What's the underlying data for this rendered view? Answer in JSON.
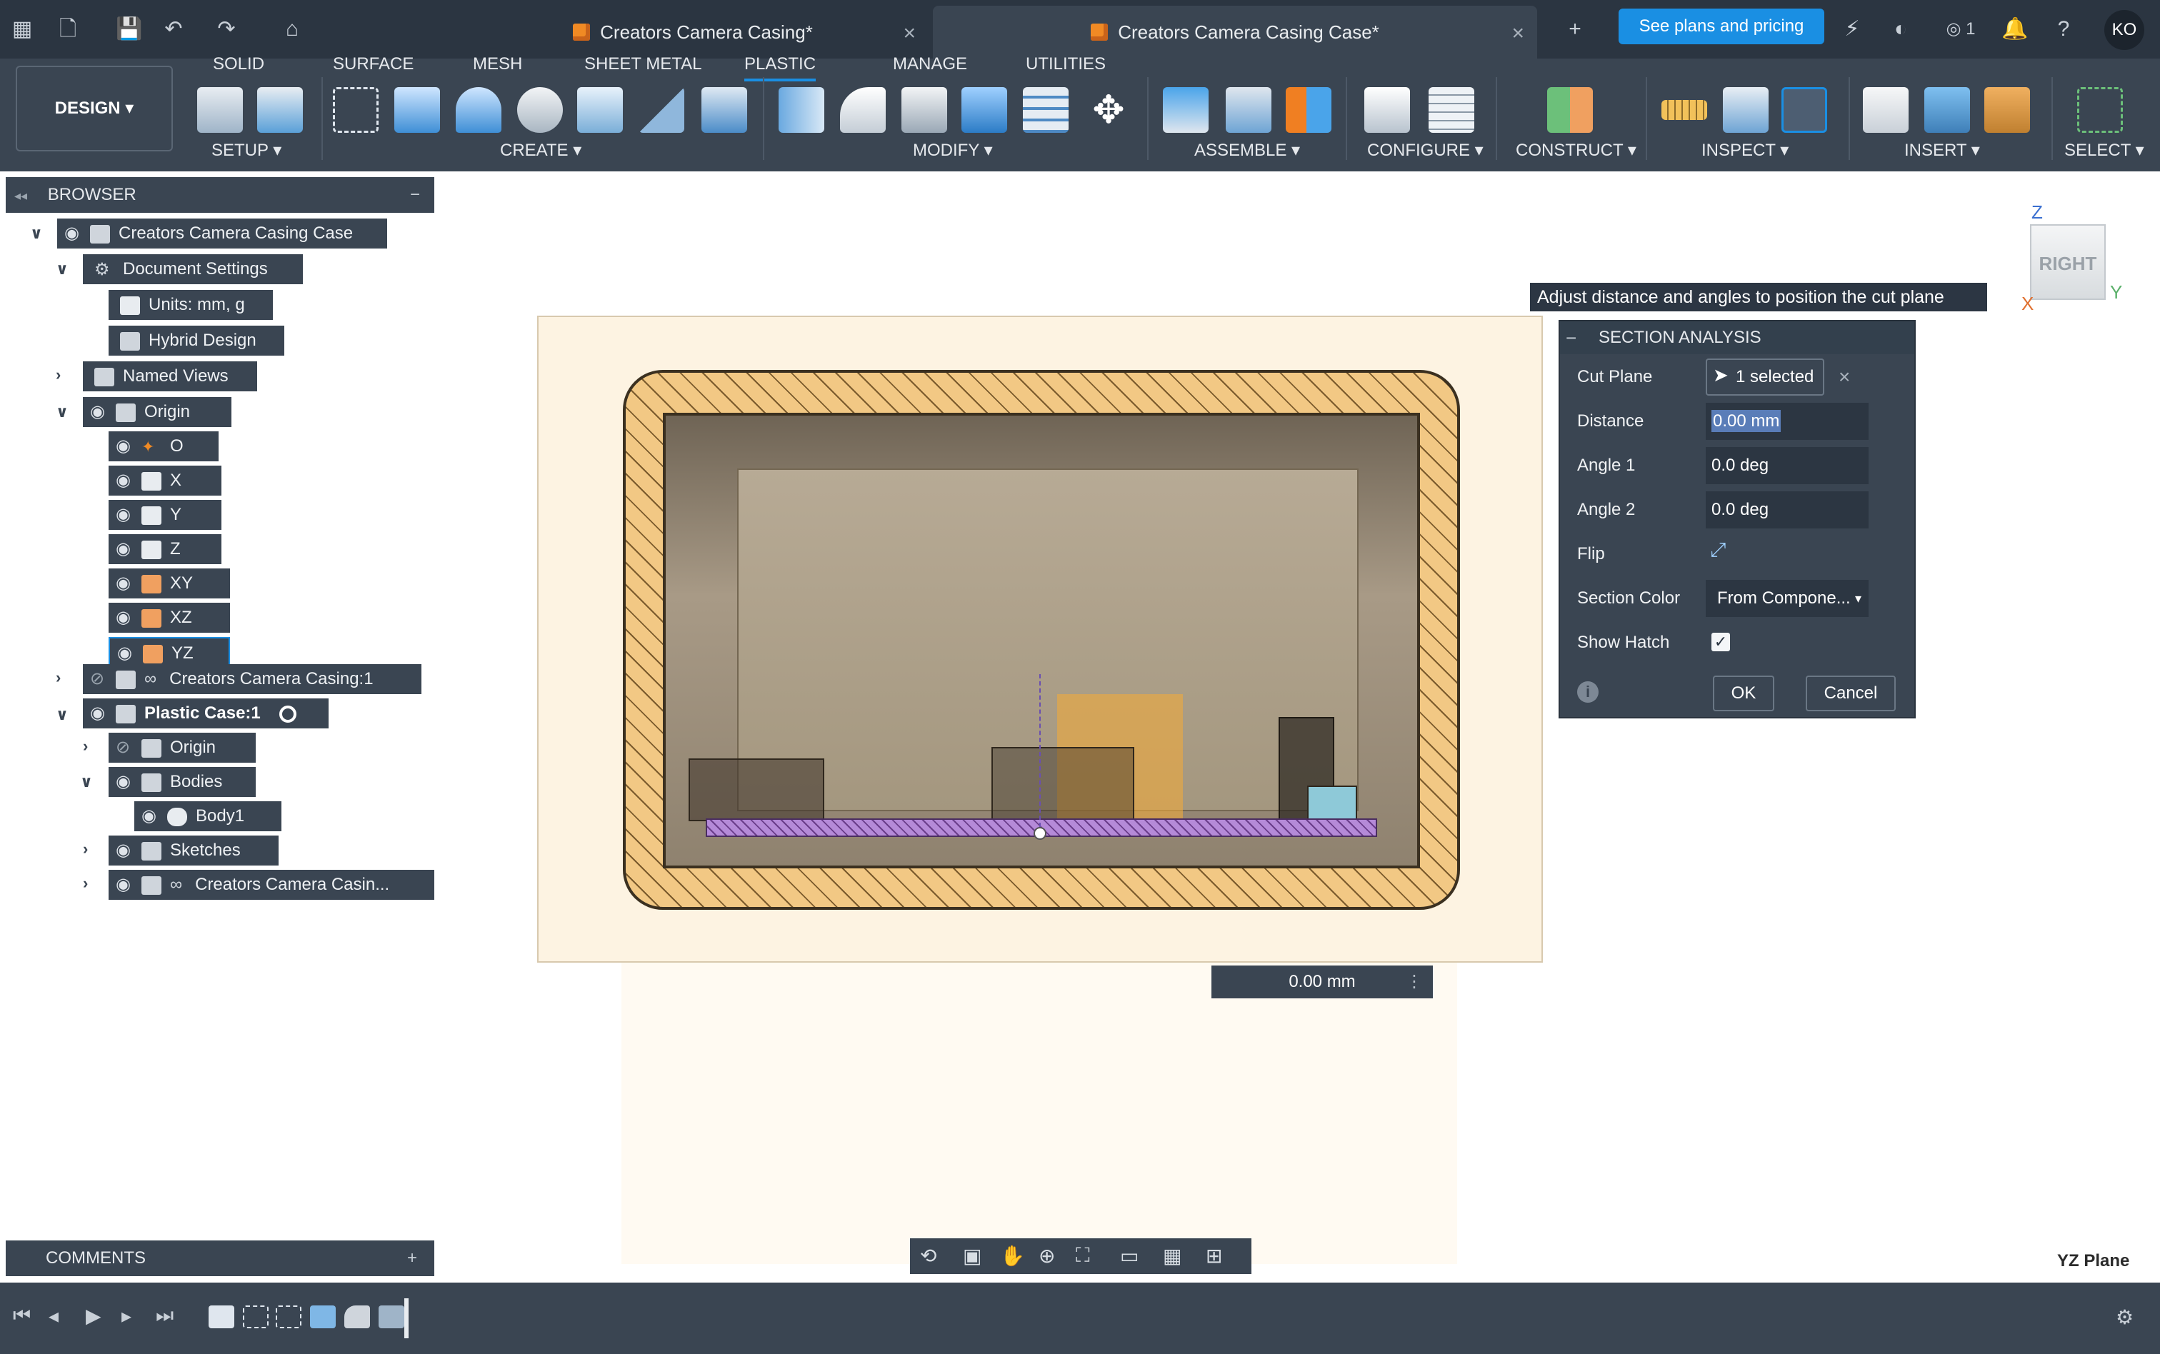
{
  "titlebar": {
    "tabs": [
      {
        "label": "Creators Camera Casing*"
      },
      {
        "label": "Creators Camera Casing Case*"
      }
    ],
    "plans_button": "See plans and pricing",
    "jobs_count": "1",
    "avatar_initials": "KO"
  },
  "toolbar": {
    "design_button": "DESIGN",
    "workspace_tabs": [
      "SOLID",
      "SURFACE",
      "MESH",
      "SHEET METAL",
      "PLASTIC",
      "MANAGE",
      "UTILITIES"
    ],
    "active_tab": "PLASTIC",
    "groups": [
      "SETUP",
      "CREATE",
      "MODIFY",
      "ASSEMBLE",
      "CONFIGURE",
      "CONSTRUCT",
      "INSPECT",
      "INSERT",
      "SELECT"
    ]
  },
  "browser": {
    "title": "BROWSER",
    "items": [
      {
        "label": "Creators Camera Casing Case"
      },
      {
        "label": "Document Settings"
      },
      {
        "label": "Units: mm, g"
      },
      {
        "label": "Hybrid Design"
      },
      {
        "label": "Named Views"
      },
      {
        "label": "Origin"
      },
      {
        "label": "O"
      },
      {
        "label": "X"
      },
      {
        "label": "Y"
      },
      {
        "label": "Z"
      },
      {
        "label": "XY"
      },
      {
        "label": "XZ"
      },
      {
        "label": "YZ"
      },
      {
        "label": "Creators Camera Casing:1"
      },
      {
        "label": "Plastic Case:1"
      },
      {
        "label": "Origin"
      },
      {
        "label": "Bodies"
      },
      {
        "label": "Body1"
      },
      {
        "label": "Sketches"
      },
      {
        "label": "Creators Camera Casin..."
      }
    ]
  },
  "comments": {
    "title": "COMMENTS"
  },
  "viewport": {
    "distance_readout": "0.00 mm",
    "tooltip": "Adjust distance and angles to position the cut plane",
    "viewcube_face": "RIGHT",
    "axis_labels": {
      "z": "Z",
      "x": "X",
      "y": "Y"
    },
    "status_text": "YZ Plane"
  },
  "section_analysis": {
    "title": "SECTION ANALYSIS",
    "cut_plane_label": "Cut Plane",
    "cut_plane_value": "1 selected",
    "distance_label": "Distance",
    "distance_value": "0.00 mm",
    "angle1_label": "Angle 1",
    "angle1_value": "0.0 deg",
    "angle2_label": "Angle 2",
    "angle2_value": "0.0 deg",
    "flip_label": "Flip",
    "section_color_label": "Section Color",
    "section_color_value": "From Compone...",
    "show_hatch_label": "Show Hatch",
    "show_hatch_checked": true,
    "ok_label": "OK",
    "cancel_label": "Cancel"
  },
  "colors": {
    "accent": "#1a8fe3",
    "panel": "#3a4552",
    "titlebar": "#2b3541",
    "section_plane": "#fdf3e2"
  }
}
